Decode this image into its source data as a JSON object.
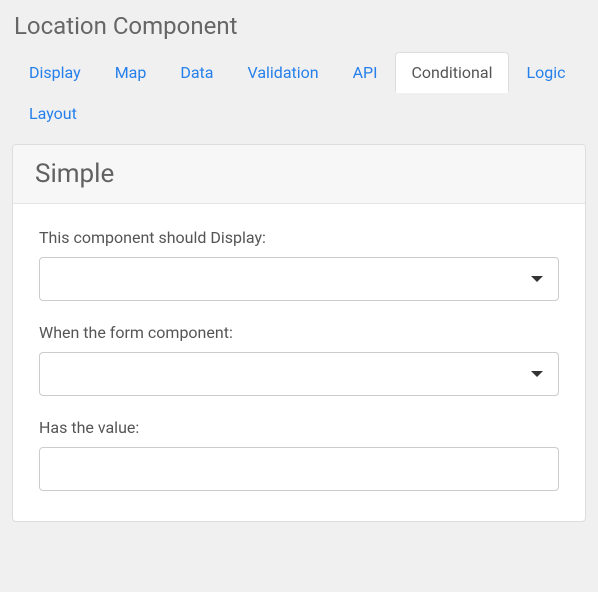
{
  "title": "Location Component",
  "tabs": [
    {
      "label": "Display",
      "active": false
    },
    {
      "label": "Map",
      "active": false
    },
    {
      "label": "Data",
      "active": false
    },
    {
      "label": "Validation",
      "active": false
    },
    {
      "label": "API",
      "active": false
    },
    {
      "label": "Conditional",
      "active": true
    },
    {
      "label": "Logic",
      "active": false
    },
    {
      "label": "Layout",
      "active": false
    }
  ],
  "panel": {
    "title": "Simple",
    "fields": {
      "display": {
        "label": "This component should Display:",
        "value": ""
      },
      "when": {
        "label": "When the form component:",
        "value": ""
      },
      "hasValue": {
        "label": "Has the value:",
        "value": ""
      }
    }
  }
}
